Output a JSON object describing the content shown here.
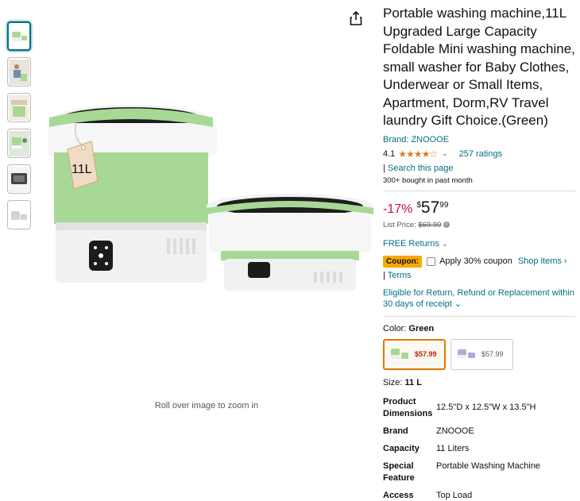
{
  "thumbnails": [
    "product-main",
    "lifestyle-1",
    "lifestyle-2",
    "lifestyle-3",
    "lifestyle-4",
    "product-white"
  ],
  "zoom_hint": "Roll over image to zoom in",
  "tag_label": "11L",
  "product": {
    "title": "Portable washing machine,11L Upgraded Large Capacity Foldable Mini washing machine, small washer for Baby Clothes, Underwear or Small Items, Apartment, Dorm,RV Travel laundry Gift Choice.(Green)",
    "brand_link": "Brand: ZNOOOE",
    "rating": "4.1",
    "stars": "★★★★☆",
    "rating_caret": "⌄",
    "ratings_count": "257 ratings",
    "search_page_sep": "|",
    "search_page": "Search this page",
    "bought": "300+ bought in past month"
  },
  "price": {
    "discount": "-17%",
    "currency": "$",
    "whole": "57",
    "fraction": "99",
    "list_label": "List Price:",
    "list_value": "$69.99",
    "info_icon": "i"
  },
  "returns": {
    "label": "FREE Returns",
    "caret": "⌄"
  },
  "coupon": {
    "badge": "Coupon:",
    "text": "Apply 30% coupon",
    "shop_items": "Shop items ›",
    "terms_sep": "|",
    "terms": "Terms"
  },
  "eligible": "Eligible for Return, Refund or Replacement within 30 days of receipt ⌄",
  "color": {
    "label": "Color:",
    "value": "Green",
    "options": [
      {
        "price": "$57.99",
        "color": "green"
      },
      {
        "price": "$57.99",
        "color": "purple"
      }
    ]
  },
  "size": {
    "label": "Size:",
    "value": "11 L"
  },
  "specs": [
    {
      "key": "Product Dimensions",
      "value": "12.5\"D x 12.5\"W x 13.5\"H"
    },
    {
      "key": "Brand",
      "value": "ZNOOOE"
    },
    {
      "key": "Capacity",
      "value": "11 Liters"
    },
    {
      "key": "Special Feature",
      "value": "Portable Washing Machine"
    },
    {
      "key": "Access",
      "value": "Top Load"
    }
  ],
  "colors": {
    "accent": "#007185",
    "deal": "#cc0c39",
    "coupon": "#f7a900",
    "star": "#de7921",
    "machine_green": "#a8d896"
  }
}
